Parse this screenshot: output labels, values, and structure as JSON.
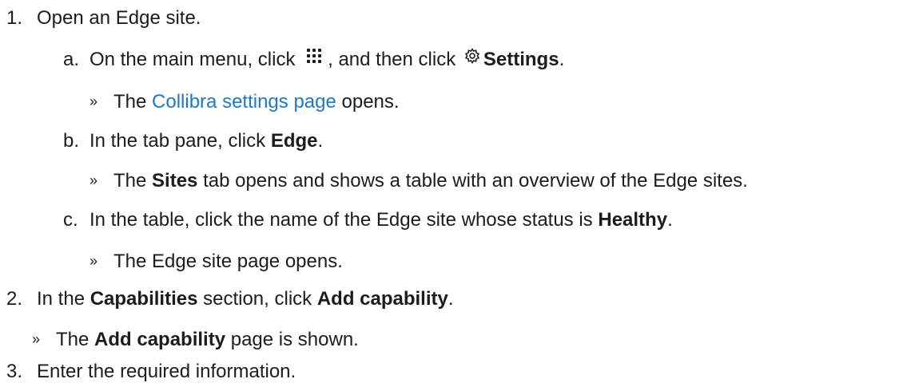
{
  "steps": [
    {
      "num": "1.",
      "text": "Open an Edge site.",
      "substeps": [
        {
          "letter": "a.",
          "p1": "On the main menu, click",
          "p2": ", and then click",
          "bold": "Settings",
          "p3": ".",
          "result": {
            "marker": "»",
            "p1": "The",
            "link": "Collibra settings page",
            "p2": "opens."
          }
        },
        {
          "letter": "b.",
          "p1": "In the tab pane, click",
          "bold": "Edge",
          "p2": ".",
          "result": {
            "marker": "»",
            "p1": "The",
            "bold": "Sites",
            "p2": "tab opens and shows a table with an overview of the Edge sites."
          }
        },
        {
          "letter": "c.",
          "p1": "In the table, click the name of the Edge site whose status is",
          "bold": "Healthy",
          "p2": ".",
          "result": {
            "marker": "»",
            "text": "The Edge site page opens."
          }
        }
      ]
    },
    {
      "num": "2.",
      "p1": "In the",
      "bold1": "Capabilities",
      "p2": "section, click",
      "bold2": "Add capability",
      "p3": ".",
      "result": {
        "marker": "»",
        "p1": "The",
        "bold": "Add capability",
        "p2": "page is shown."
      }
    },
    {
      "num": "3.",
      "text": "Enter the required information."
    }
  ],
  "icons": {
    "apps": "apps-grid-icon",
    "settings": "gear-icon"
  }
}
